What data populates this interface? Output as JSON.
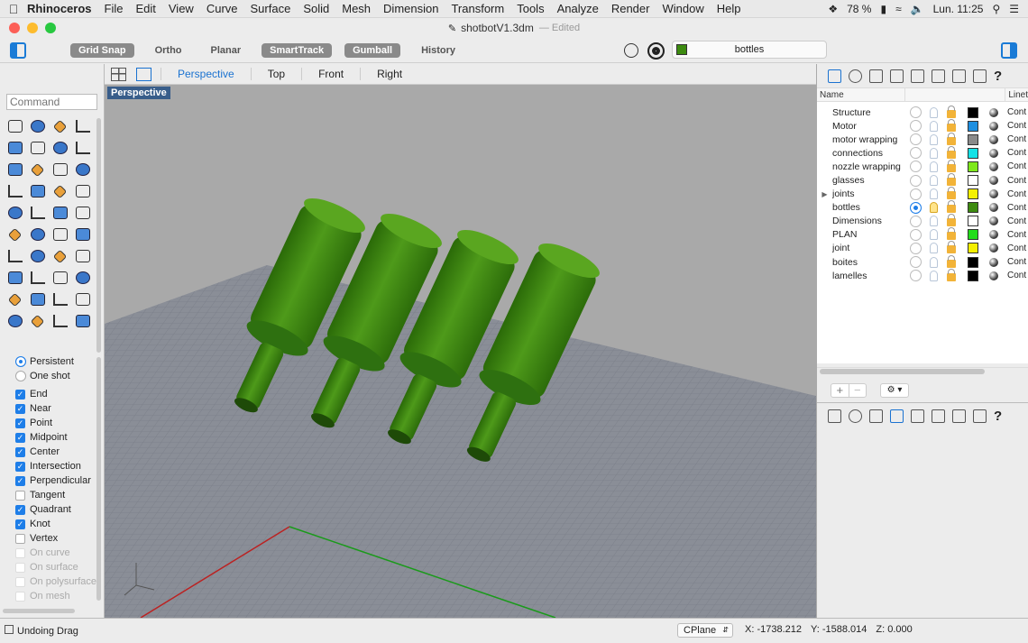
{
  "menubar": {
    "app": "Rhinoceros",
    "items": [
      "File",
      "Edit",
      "View",
      "Curve",
      "Surface",
      "Solid",
      "Mesh",
      "Dimension",
      "Transform",
      "Tools",
      "Analyze",
      "Render",
      "Window",
      "Help"
    ],
    "battery": "78 %",
    "clock": "Lun. 11:25"
  },
  "titlebar": {
    "filename": "shotbotV1.3dm",
    "edited": "— Edited"
  },
  "toolbar": {
    "buttons": [
      {
        "label": "Grid Snap",
        "on": true
      },
      {
        "label": "Ortho",
        "on": false
      },
      {
        "label": "Planar",
        "on": false
      },
      {
        "label": "SmartTrack",
        "on": true
      },
      {
        "label": "Gumball",
        "on": true
      },
      {
        "label": "History",
        "on": false
      }
    ],
    "current_layer": "bottles",
    "current_layer_color": "#3d8b10"
  },
  "command": {
    "placeholder": "Command"
  },
  "snaps": {
    "mode": [
      {
        "label": "Persistent",
        "selected": true
      },
      {
        "label": "One shot",
        "selected": false
      }
    ],
    "items": [
      {
        "label": "End",
        "checked": true
      },
      {
        "label": "Near",
        "checked": true
      },
      {
        "label": "Point",
        "checked": true
      },
      {
        "label": "Midpoint",
        "checked": true
      },
      {
        "label": "Center",
        "checked": true
      },
      {
        "label": "Intersection",
        "checked": true
      },
      {
        "label": "Perpendicular",
        "checked": true
      },
      {
        "label": "Tangent",
        "checked": false
      },
      {
        "label": "Quadrant",
        "checked": true
      },
      {
        "label": "Knot",
        "checked": true
      },
      {
        "label": "Vertex",
        "checked": false
      },
      {
        "label": "On curve",
        "checked": false,
        "disabled": true
      },
      {
        "label": "On surface",
        "checked": false,
        "disabled": true
      },
      {
        "label": "On polysurface",
        "checked": false,
        "disabled": true
      },
      {
        "label": "On mesh",
        "checked": false,
        "disabled": true
      }
    ]
  },
  "viewports": {
    "tabs": [
      "Perspective",
      "Top",
      "Front",
      "Right"
    ],
    "active": "Perspective",
    "label": "Perspective"
  },
  "layers": {
    "header": {
      "name": "Name",
      "linetype": "Linet"
    },
    "rows": [
      {
        "name": "Structure",
        "color": "#000000",
        "current": false,
        "expandable": false
      },
      {
        "name": "Motor",
        "color": "#1e8fe0",
        "current": false,
        "expandable": false
      },
      {
        "name": "motor wrapping",
        "color": "#8a8a8a",
        "current": false,
        "expandable": false
      },
      {
        "name": "connections",
        "color": "#14e2e6",
        "current": false,
        "expandable": false
      },
      {
        "name": "nozzle wrapping",
        "color": "#7ee81c",
        "current": false,
        "expandable": false
      },
      {
        "name": "glasses",
        "color": "#ffffff",
        "current": false,
        "expandable": false
      },
      {
        "name": "joints",
        "color": "#f5f000",
        "current": false,
        "expandable": true
      },
      {
        "name": "bottles",
        "color": "#3d8b10",
        "current": true,
        "expandable": false
      },
      {
        "name": "Dimensions",
        "color": "#ffffff",
        "current": false,
        "expandable": false
      },
      {
        "name": "PLAN",
        "color": "#22dd1a",
        "current": false,
        "expandable": false
      },
      {
        "name": "joint",
        "color": "#f5f000",
        "current": false,
        "expandable": false
      },
      {
        "name": "boites",
        "color": "#000000",
        "current": false,
        "expandable": false
      },
      {
        "name": "lamelles",
        "color": "#000000",
        "current": false,
        "expandable": false
      }
    ],
    "linetype_value": "Cont"
  },
  "statusbar": {
    "message": "Undoing Drag",
    "cplane": "CPlane",
    "x": "X: -1738.212",
    "y": "Y: -1588.014",
    "z": "Z: 0.000"
  }
}
